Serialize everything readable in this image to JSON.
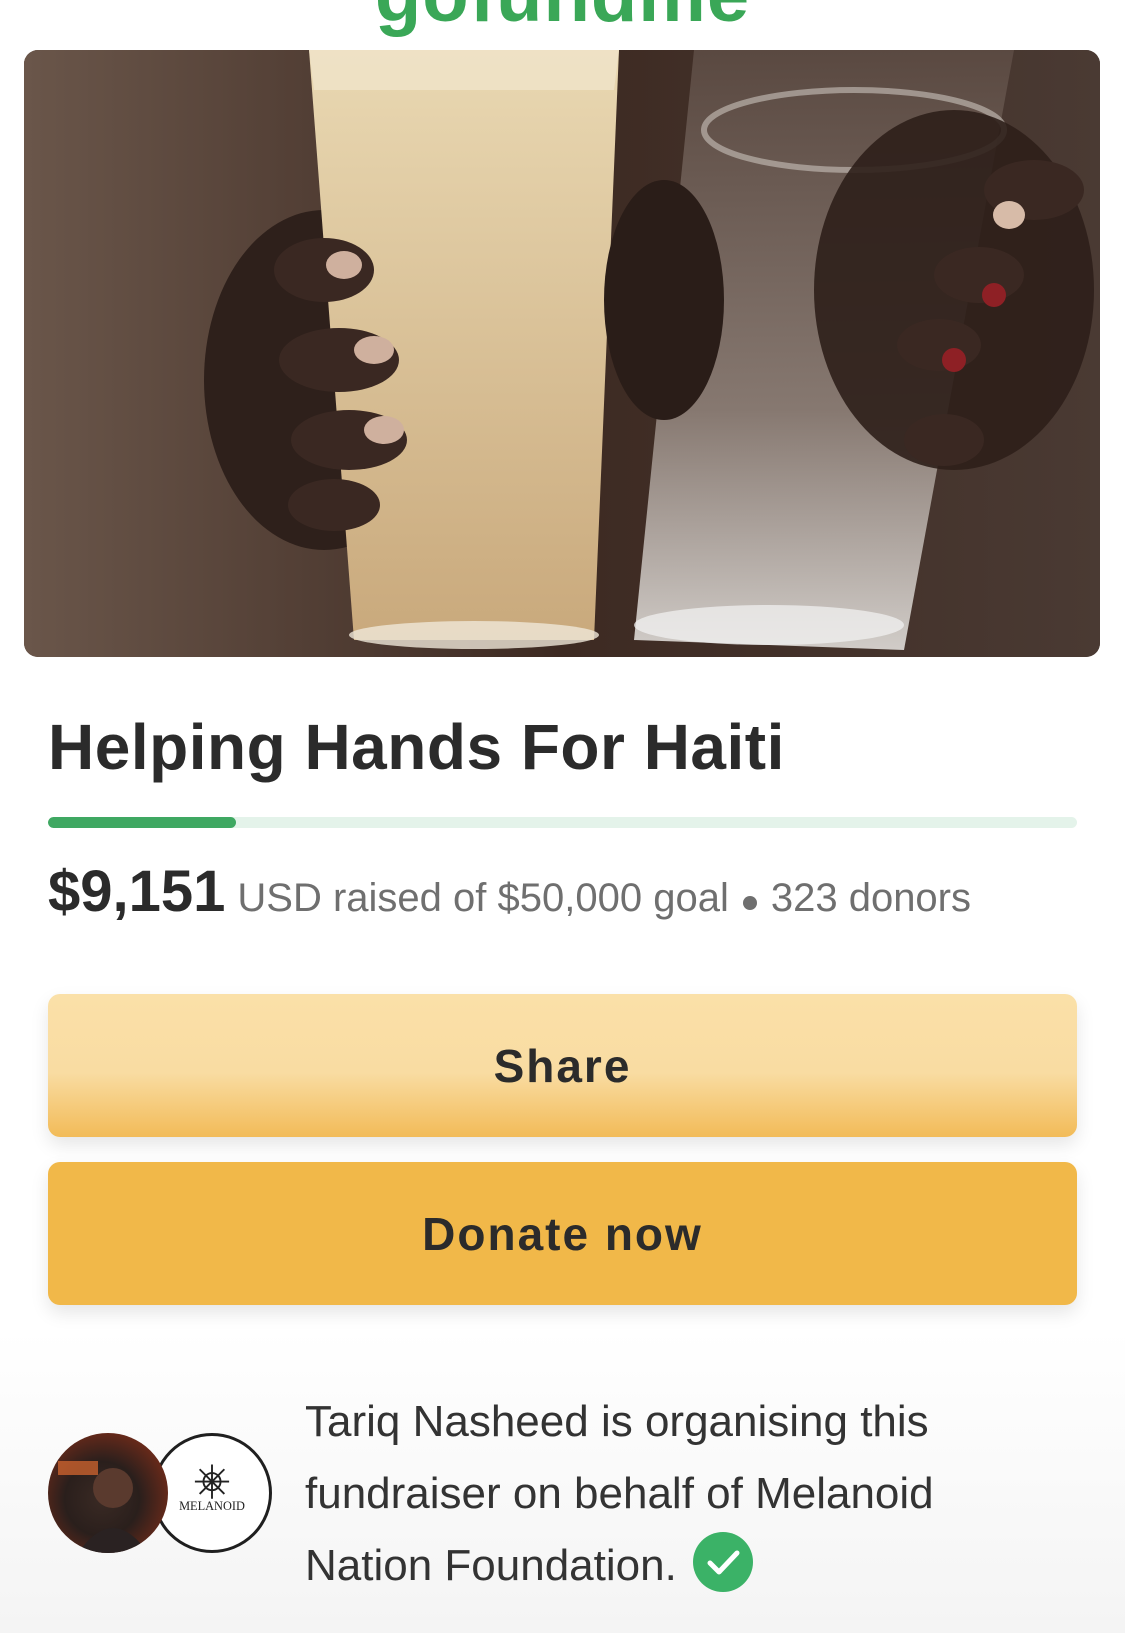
{
  "brand": {
    "logo_text": "gofundme",
    "accent": "#3aa757"
  },
  "hero": {
    "image_icon": "water-glasses-photo"
  },
  "campaign": {
    "title": "Helping Hands For Haiti",
    "progress_fraction": 0.183,
    "raised": "$9,151",
    "currency_meta": "USD raised of $50,000 goal",
    "donors": "323 donors"
  },
  "actions": {
    "share_label": "Share",
    "donate_label": "Donate now"
  },
  "organizer": {
    "text": "Tariq Nasheed is organising this fundraiser on behalf of Melanoid Nation Foundation.",
    "org_logo_text": "MELANOID",
    "verified_icon": "check-circle-icon"
  },
  "colors": {
    "progress": "#3fa862",
    "share_bg": "#fae0a8",
    "donate_bg": "#f1b849"
  }
}
